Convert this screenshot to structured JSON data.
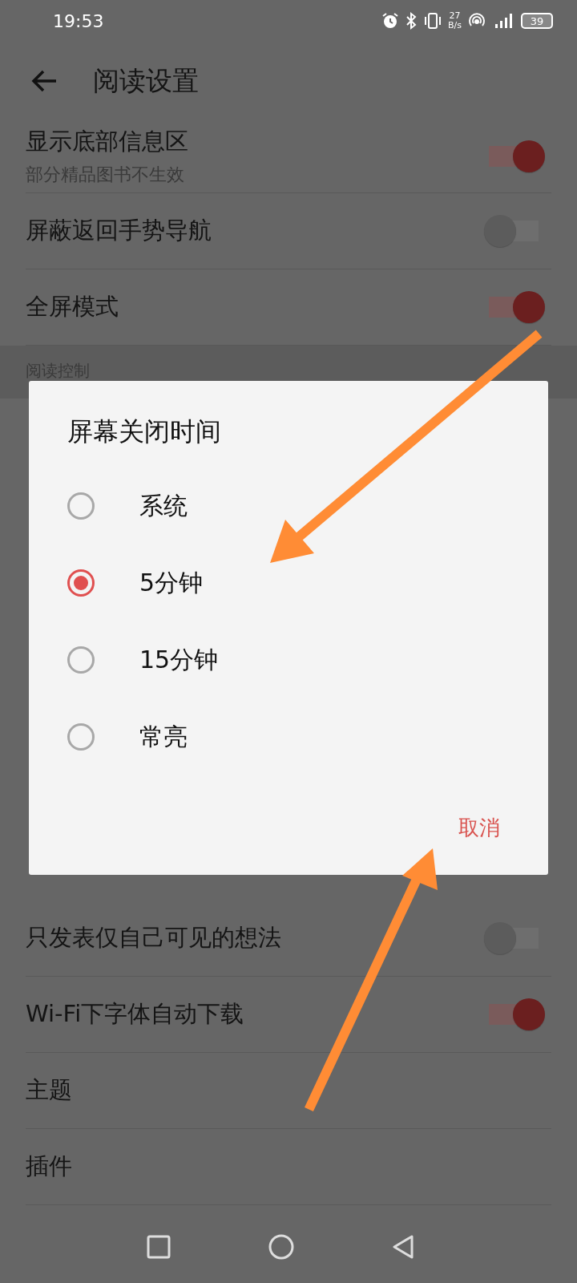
{
  "status_bar": {
    "time": "19:53",
    "speed_value": "27",
    "speed_unit": "B/s",
    "battery": "39"
  },
  "header": {
    "title": "阅读设置"
  },
  "settings_top": [
    {
      "kind": "switch",
      "label": "显示底部信息区",
      "subtitle": "部分精品图书不生效",
      "on": true
    },
    {
      "kind": "switch",
      "label": "屏蔽返回手势导航",
      "on": false
    },
    {
      "kind": "switch",
      "label": "全屏模式",
      "on": true
    }
  ],
  "section_header": "阅读控制",
  "settings_bottom": [
    {
      "kind": "switch",
      "label": "只发表仅自己可见的想法",
      "on": false
    },
    {
      "kind": "switch",
      "label": "Wi-Fi下字体自动下载",
      "on": true
    },
    {
      "kind": "link",
      "label": "主题"
    },
    {
      "kind": "link",
      "label": "插件"
    }
  ],
  "dialog": {
    "title": "屏幕关闭时间",
    "options": [
      {
        "label": "系统",
        "selected": false
      },
      {
        "label": "5分钟",
        "selected": true
      },
      {
        "label": "15分钟",
        "selected": false
      },
      {
        "label": "常亮",
        "selected": false
      }
    ],
    "cancel": "取消"
  }
}
